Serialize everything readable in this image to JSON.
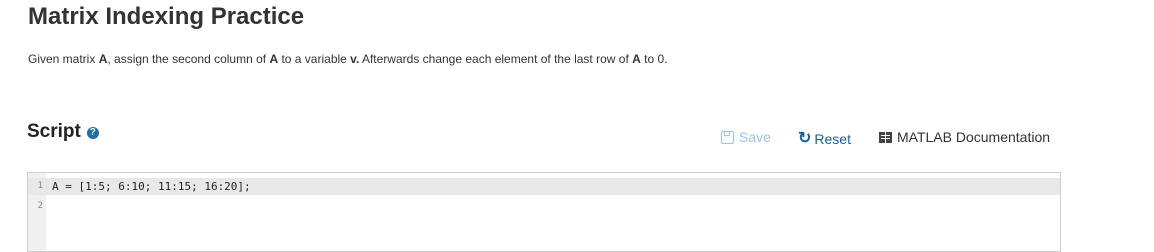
{
  "page": {
    "title": "Matrix Indexing Practice"
  },
  "description": {
    "part1": "Given matrix ",
    "bold1": "A",
    "part2": ", assign the second column of ",
    "bold2": "A",
    "part3": " to a variable ",
    "bold3": "v.",
    "part4": "  Afterwards change each element of the last row of ",
    "bold4": "A",
    "part5": " to 0."
  },
  "script": {
    "heading": "Script",
    "help_icon": "?"
  },
  "toolbar": {
    "save_label": "Save",
    "reset_label": "Reset",
    "doc_label": "MATLAB Documentation",
    "reset_icon": "↻",
    "colors": {
      "save_disabled": "#9cc3e0",
      "reset": "#1a5d9a"
    }
  },
  "editor": {
    "lines": [
      {
        "num": "1",
        "text": "A = [1:5; 6:10; 11:15; 16:20];"
      },
      {
        "num": "2",
        "text": ""
      }
    ]
  }
}
